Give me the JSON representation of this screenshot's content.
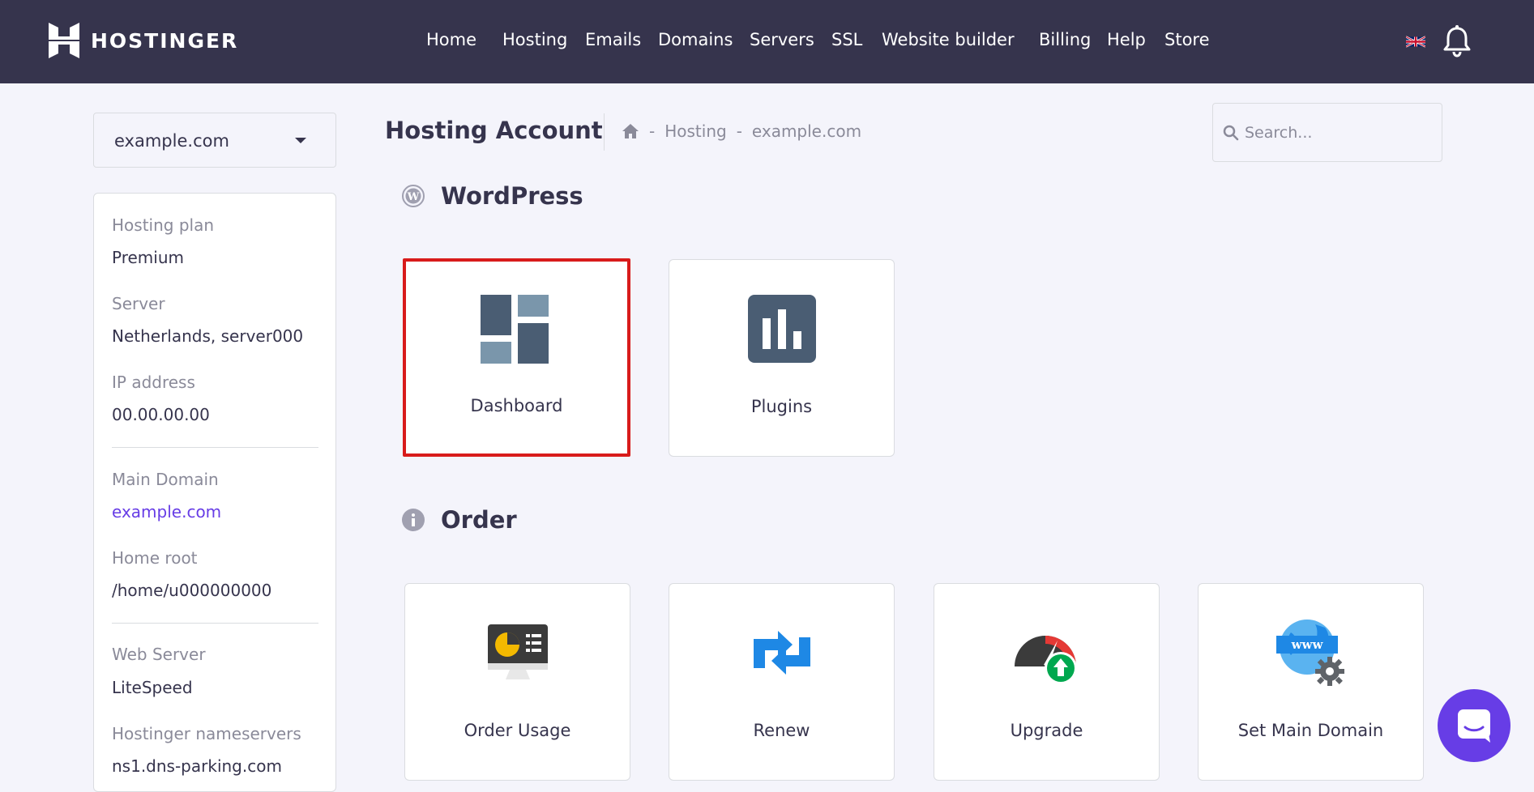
{
  "brand": {
    "name": "HOSTINGER"
  },
  "nav": {
    "items": [
      "Home",
      "Hosting",
      "Emails",
      "Domains",
      "Servers",
      "SSL",
      "Website builder",
      "Billing",
      "Help",
      "Store"
    ]
  },
  "domain_selector": {
    "value": "example.com"
  },
  "info": {
    "hosting_plan_label": "Hosting plan",
    "hosting_plan": "Premium",
    "server_label": "Server",
    "server": "Netherlands, server000",
    "ip_label": "IP address",
    "ip": "00.00.00.00",
    "main_domain_label": "Main Domain",
    "main_domain": "example.com",
    "home_root_label": "Home root",
    "home_root": "/home/u000000000",
    "web_server_label": "Web Server",
    "web_server": "LiteSpeed",
    "nameservers_label": "Hostinger nameservers",
    "nameserver_1": "ns1.dns-parking.com"
  },
  "header": {
    "title": "Hosting Account",
    "breadcrumb": [
      "Hosting",
      "example.com"
    ],
    "separator": "-"
  },
  "search": {
    "placeholder": "Search..."
  },
  "sections": {
    "wordpress": {
      "title": "WordPress",
      "tiles": [
        {
          "label": "Dashboard",
          "icon": "dashboard-icon"
        },
        {
          "label": "Plugins",
          "icon": "plugins-icon"
        }
      ]
    },
    "order": {
      "title": "Order",
      "tiles": [
        {
          "label": "Order Usage",
          "icon": "order-usage-icon"
        },
        {
          "label": "Renew",
          "icon": "renew-icon"
        },
        {
          "label": "Upgrade",
          "icon": "upgrade-icon"
        },
        {
          "label": "Set Main Domain",
          "icon": "set-main-domain-icon"
        }
      ]
    }
  },
  "colors": {
    "topbar": "#36344d",
    "accent": "#673de6",
    "highlight": "#d81b1b",
    "page_bg": "#f4f4fb"
  }
}
